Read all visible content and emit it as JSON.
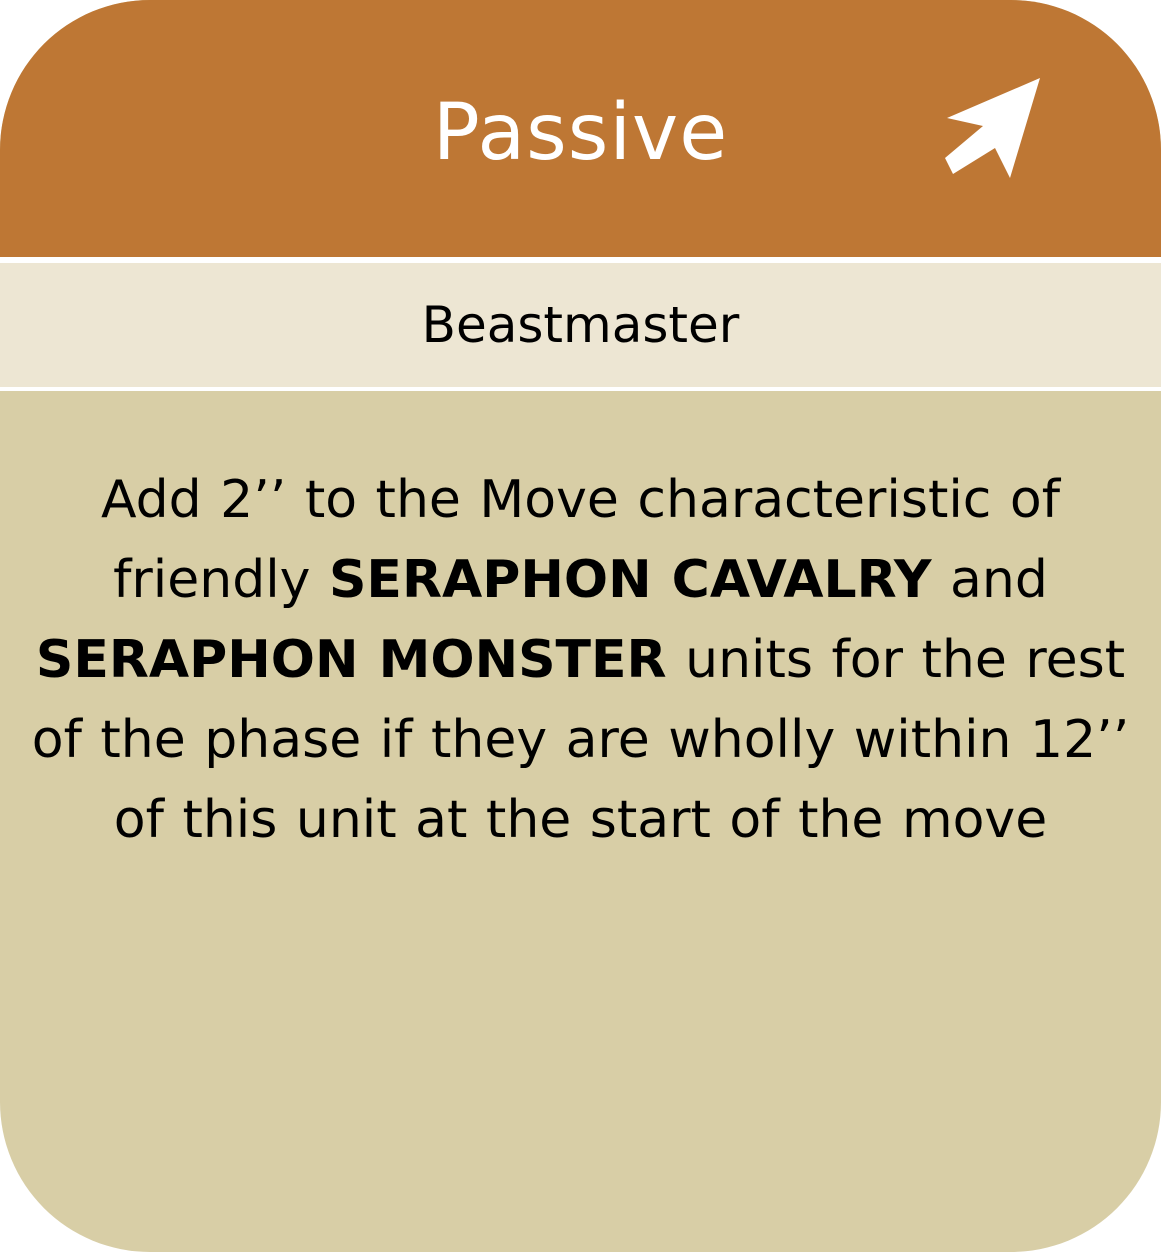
{
  "card": {
    "title": "Passive",
    "ability_name": "Beastmaster",
    "icon": "arrow-up-right-icon",
    "colors": {
      "header": "#be7734",
      "subheader": "#ede6d3",
      "body": "#d8cea6"
    },
    "description": {
      "part1": "Add 2’’ to the Move characteristic of friendly ",
      "keyword1": "SERAPHON CAVALRY",
      "part2": " and ",
      "keyword2": "SERAPHON MONSTER",
      "part3": " units for the rest of the phase if they are wholly within 12’’ of this unit at the start of the move"
    }
  }
}
